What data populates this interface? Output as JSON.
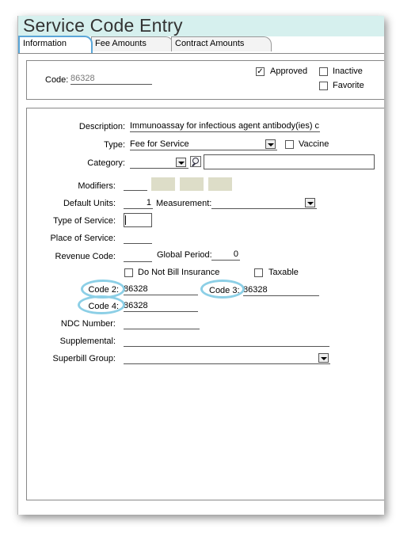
{
  "window": {
    "title": "Service Code Entry"
  },
  "tabs": [
    {
      "label": "Information",
      "active": true
    },
    {
      "label": "Fee Amounts",
      "active": false
    },
    {
      "label": "Contract Amounts",
      "active": false
    }
  ],
  "header": {
    "code_label": "Code:",
    "code_value": "86328",
    "approved_label": "Approved",
    "approved_checked": true,
    "approved_mark": "✓",
    "inactive_label": "Inactive",
    "favorite_label": "Favorite"
  },
  "form": {
    "description_label": "Description:",
    "description_value": "Immunoassay for infectious agent antibody(ies)  c",
    "type_label": "Type:",
    "type_value": "Fee for Service",
    "vaccine_label": "Vaccine",
    "category_label": "Category:",
    "category_value": "",
    "modifiers_label": "Modifiers:",
    "default_units_label": "Default Units:",
    "default_units_value": "1",
    "measurement_label": "Measurement:",
    "measurement_value": "",
    "type_of_service_label": "Type of Service:",
    "place_of_service_label": "Place of Service:",
    "revenue_code_label": "Revenue Code:",
    "global_period_label": "Global Period:",
    "global_period_value": "0",
    "do_not_bill_label": "Do Not Bill Insurance",
    "taxable_label": "Taxable",
    "code2_label": "Code 2:",
    "code2_value": "86328",
    "code3_label": "Code 3:",
    "code3_value": "86328",
    "code4_label": "Code 4:",
    "code4_value": "86328",
    "ndc_label": "NDC Number:",
    "supplemental_label": "Supplemental:",
    "superbill_label": "Superbill Group:",
    "superbill_value": ""
  },
  "colors": {
    "title_bar": "#d6f0ee",
    "highlight_ring": "#8ccfe6",
    "modifier_fill": "#ddddc8"
  }
}
